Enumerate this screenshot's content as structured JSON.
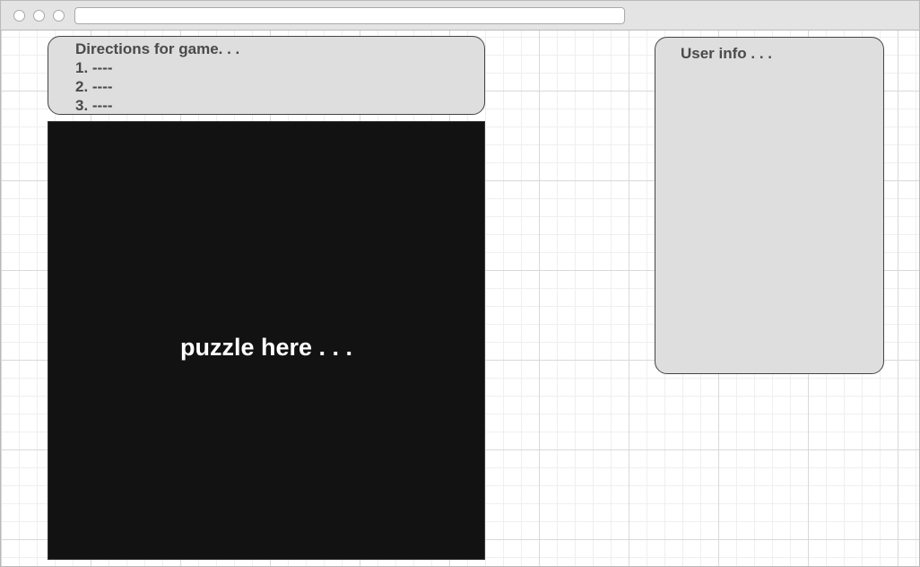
{
  "directions": {
    "title": "Directions for game. . .",
    "steps": [
      "1. ----",
      "2. ----",
      "3. ----"
    ]
  },
  "puzzle": {
    "label": "puzzle here . . ."
  },
  "user_info": {
    "title": "User info . . ."
  },
  "colors": {
    "panel_fill": "#dedede",
    "puzzle_fill": "#121212",
    "text": "#4a4a4a"
  }
}
